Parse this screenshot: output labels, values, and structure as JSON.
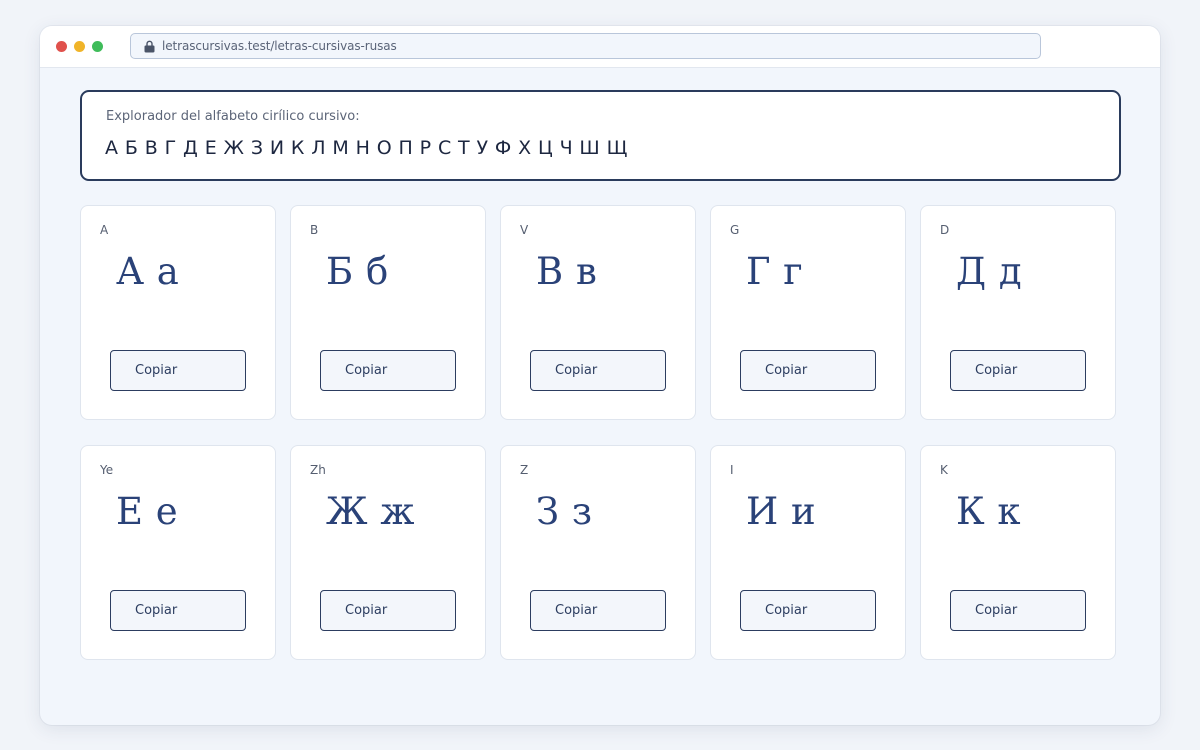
{
  "browser": {
    "url": "letrascursivas.test/letras-cursivas-rusas"
  },
  "explorer": {
    "label": "Explorador del alfabeto cirílico cursivo:",
    "alphabet": "А Б В Г Д Е Ж З И К Л М Н О П Р С Т У Ф Х Ц Ч Ш Щ"
  },
  "cards": [
    {
      "translit": "A",
      "glyph": "А а",
      "button": "Copiar"
    },
    {
      "translit": "B",
      "glyph": "Б б",
      "button": "Copiar"
    },
    {
      "translit": "V",
      "glyph": "В в",
      "button": "Copiar"
    },
    {
      "translit": "G",
      "glyph": "Г г",
      "button": "Copiar"
    },
    {
      "translit": "D",
      "glyph": "Д д",
      "button": "Copiar"
    },
    {
      "translit": "Ye",
      "glyph": "Е е",
      "button": "Copiar"
    },
    {
      "translit": "Zh",
      "glyph": "Ж ж",
      "button": "Copiar"
    },
    {
      "translit": "Z",
      "glyph": "З з",
      "button": "Copiar"
    },
    {
      "translit": "I",
      "glyph": "И и",
      "button": "Copiar"
    },
    {
      "translit": "K",
      "glyph": "К к",
      "button": "Copiar"
    }
  ],
  "colors": {
    "accent": "#2a4278",
    "border": "#2a3b5c",
    "background": "#f2f6fc"
  },
  "icons": {
    "lock": "lock-icon"
  }
}
